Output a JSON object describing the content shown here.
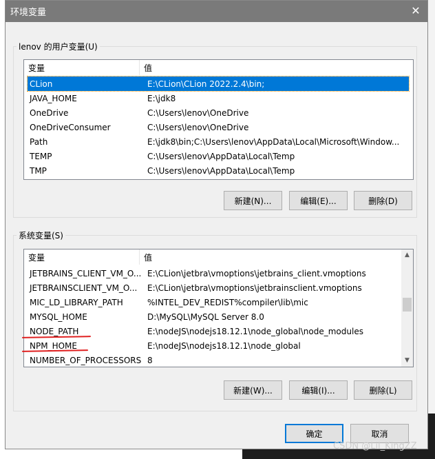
{
  "window": {
    "title": "环境变量",
    "close_icon": "close-icon"
  },
  "user_vars": {
    "label": "lenov 的用户变量(U)",
    "columns": [
      "变量",
      "值"
    ],
    "rows": [
      {
        "name": "CLion",
        "value": "E:\\CLion\\CLion 2022.2.4\\bin;",
        "selected": true
      },
      {
        "name": "JAVA_HOME",
        "value": "E:\\jdk8"
      },
      {
        "name": "OneDrive",
        "value": "C:\\Users\\lenov\\OneDrive"
      },
      {
        "name": "OneDriveConsumer",
        "value": "C:\\Users\\lenov\\OneDrive"
      },
      {
        "name": "Path",
        "value": "E:\\jdk8\\bin;C:\\Users\\lenov\\AppData\\Local\\Microsoft\\Window..."
      },
      {
        "name": "TEMP",
        "value": "C:\\Users\\lenov\\AppData\\Local\\Temp"
      },
      {
        "name": "TMP",
        "value": "C:\\Users\\lenov\\AppData\\Local\\Temp"
      }
    ],
    "buttons": {
      "new": "新建(N)...",
      "edit": "编辑(E)...",
      "delete": "删除(D)"
    }
  },
  "system_vars": {
    "label": "系统变量(S)",
    "columns": [
      "变量",
      "值"
    ],
    "rows": [
      {
        "name": "JETBRAINS_CLIENT_VM_O...",
        "value": "E:\\CLion\\jetbra\\vmoptions\\jetbrains_client.vmoptions"
      },
      {
        "name": "JETBRAINSCLIENT_VM_O...",
        "value": "E:\\CLion\\jetbra\\vmoptions\\jetbrainsclient.vmoptions"
      },
      {
        "name": "MIC_LD_LIBRARY_PATH",
        "value": "%INTEL_DEV_REDIST%compiler\\lib\\mic"
      },
      {
        "name": "MYSQL_HOME",
        "value": "D:\\MySQL\\MySQL Server 8.0"
      },
      {
        "name": "NODE_PATH",
        "value": "E:\\nodeJS\\nodejs18.12.1\\node_global\\node_modules"
      },
      {
        "name": "NPM_HOME",
        "value": "E:\\nodeJS\\nodejs18.12.1\\node_global"
      },
      {
        "name": "NUMBER_OF_PROCESSORS",
        "value": "8"
      }
    ],
    "buttons": {
      "new": "新建(W)...",
      "edit": "编辑(I)...",
      "delete": "删除(L)"
    }
  },
  "footer": {
    "ok": "确定",
    "cancel": "取消"
  },
  "watermark": "CSDN @Lil_KingZZ",
  "colors": {
    "selection": "#0078d7",
    "titlebar": "#7a7a7a",
    "annotation": "#e02020"
  }
}
